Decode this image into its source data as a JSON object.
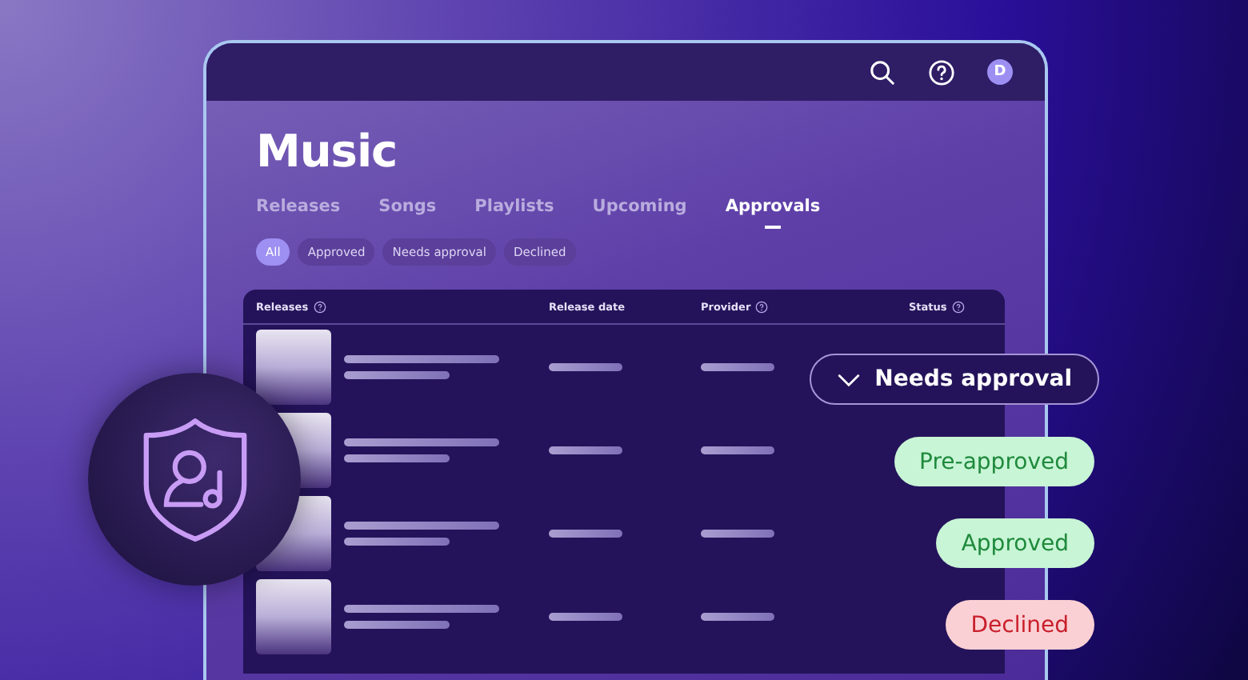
{
  "header": {
    "avatar": "D"
  },
  "title": "Music",
  "tabs": [
    {
      "label": "Releases",
      "selected": false
    },
    {
      "label": "Songs",
      "selected": false
    },
    {
      "label": "Playlists",
      "selected": false
    },
    {
      "label": "Upcoming",
      "selected": false
    },
    {
      "label": "Approvals",
      "selected": true
    }
  ],
  "filters": [
    {
      "label": "All",
      "selected": true
    },
    {
      "label": "Approved",
      "selected": false
    },
    {
      "label": "Needs approval",
      "selected": false
    },
    {
      "label": "Declined",
      "selected": false
    }
  ],
  "table": {
    "columns": [
      {
        "label": "Releases",
        "help": true
      },
      {
        "label": "Release date",
        "help": false
      },
      {
        "label": "Provider",
        "help": true
      },
      {
        "label": "Status",
        "help": true
      }
    ],
    "rows": [
      {
        "kind": "placeholder"
      },
      {
        "kind": "placeholder"
      },
      {
        "kind": "placeholder"
      },
      {
        "kind": "placeholder"
      }
    ]
  },
  "statuses": [
    {
      "label": "Needs approval",
      "kind": "dropdown"
    },
    {
      "label": "Pre-approved",
      "kind": "positive"
    },
    {
      "label": "Approved",
      "kind": "positive"
    },
    {
      "label": "Declined",
      "kind": "negative"
    }
  ]
}
